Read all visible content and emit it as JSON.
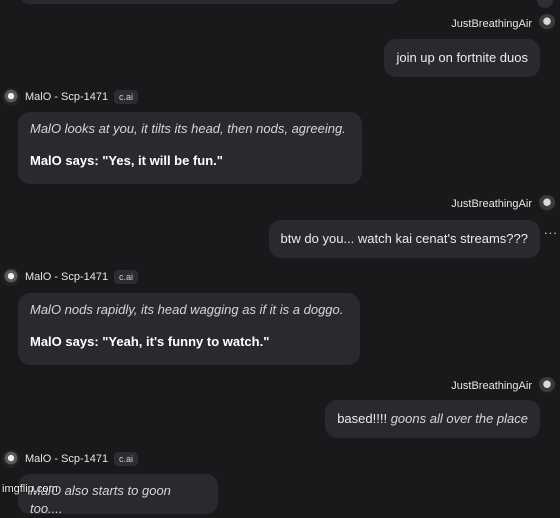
{
  "messages": [
    {
      "user_name": "JustBreathingAir",
      "text": "join up on fortnite duos"
    },
    {
      "bot_name": "MalO - Scp-1471",
      "badge": "c.ai",
      "narration": "MalO looks at you, it tilts its head, then nods, agreeing.",
      "speech": "MalO says: \"Yes, it will be fun.\""
    },
    {
      "user_name": "JustBreathingAir",
      "text": "btw do you... watch kai cenat's streams???",
      "more": "..."
    },
    {
      "bot_name": "MalO - Scp-1471",
      "badge": "c.ai",
      "narration": "MalO nods rapidly, its head wagging as if it is a doggo.",
      "speech": "MalO says: \"Yeah, it's funny to watch.\""
    },
    {
      "user_name": "JustBreathingAir",
      "text_plain": "based!!!! ",
      "text_italic": "goons all over the place"
    },
    {
      "bot_name": "MalO - Scp-1471",
      "badge": "c.ai",
      "narration": "MalO also starts to goon too...."
    }
  ],
  "watermark": "imgflip.com"
}
